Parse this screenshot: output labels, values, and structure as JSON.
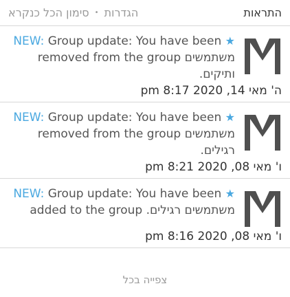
{
  "header": {
    "title": "התראות",
    "actions": [
      "הגדרות",
      "סימון הכל כנקרא"
    ],
    "separator": "•"
  },
  "notifications": [
    {
      "lines": [
        [
          "NEW:",
          " Group update: You have been ",
          "★"
        ],
        [
          "removed from the group ",
          "משתמשים"
        ],
        [
          "ותיקים."
        ]
      ],
      "date": "ה' מאי 14, 2020 8:17 pm"
    },
    {
      "lines": [
        [
          "NEW:",
          " Group update: You have been ",
          "★"
        ],
        [
          "removed from the group ",
          "משתמשים"
        ],
        [
          "רגילים."
        ]
      ],
      "date": "ו' מאי 08, 2020 8:21 pm"
    },
    {
      "lines": [
        [
          "NEW:",
          " Group update: You have been ",
          "★"
        ],
        [
          "added to the group ",
          "משתמשים רגילים."
        ]
      ],
      "date": "ו' מאי 08, 2020 8:16 pm"
    }
  ],
  "footer": {
    "see_all": "צפייה בכל"
  },
  "colors": {
    "accent": "#4aa8e0",
    "text": "#555555",
    "muted": "#999999",
    "divider": "#d8d8d8"
  },
  "icons": {
    "avatar": "default-avatar-icon",
    "star": "star-icon"
  }
}
